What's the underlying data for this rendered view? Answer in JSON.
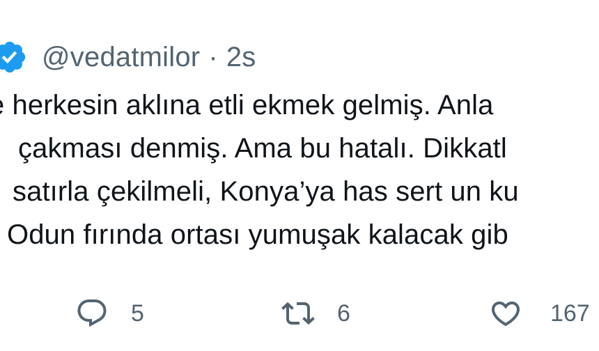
{
  "header": {
    "verified_icon": "verified-badge-icon",
    "accent_color": "#1d9bf0",
    "handle": "@vedatmilor",
    "separator": "·",
    "time": "2s"
  },
  "tweet": {
    "lines": [
      "e herkesin aklına etli ekmek gelmiş. Anla",
      "çakması denmiş. Ama bu hatalı. Dikkatl",
      "satırla çekilmeli, Konya’ya has sert un ku",
      "Odun fırında ortası yumuşak kalacak gib"
    ]
  },
  "actions": {
    "reply": {
      "icon": "reply-icon",
      "count": "5"
    },
    "retweet": {
      "icon": "retweet-icon",
      "count": "6"
    },
    "like": {
      "icon": "heart-icon",
      "count": "167"
    }
  }
}
